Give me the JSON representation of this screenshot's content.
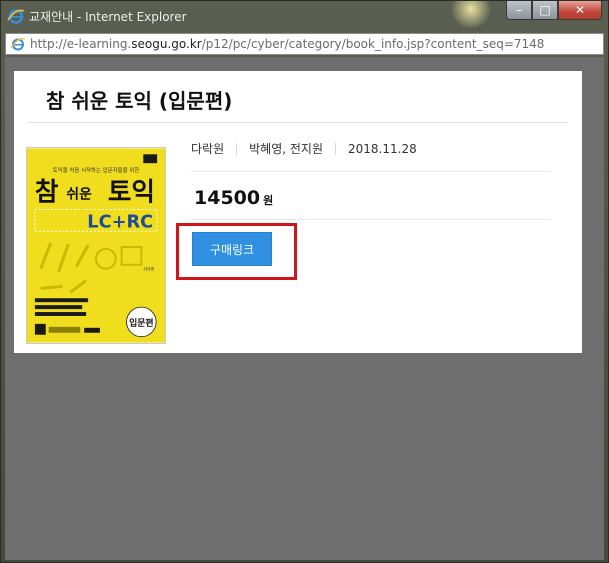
{
  "window": {
    "title": "교재안내 - Internet Explorer",
    "address_prefix": "http://e-learning.",
    "address_host": "seogu.go.kr",
    "address_path": "/p12/pc/cyber/category/book_info.jsp?content_seq=7148",
    "controls": {
      "minimize": "–",
      "maximize": "□",
      "close": "✕"
    }
  },
  "book": {
    "title": "참 쉬운 토익 (입문편)",
    "publisher": "다락원",
    "authors": "박혜영, 전지원",
    "date": "2018.11.28",
    "price": "14500",
    "price_unit": "원",
    "buy_label": "구매링크"
  },
  "cover": {
    "tagline": "토익을 처음 시작하는 입문자들을 위한",
    "title_main": "참",
    "title_mid": "쉬운",
    "title_end": "토익",
    "subtitle": "LC+RC",
    "badge": "입문편"
  },
  "colors": {
    "buy_button": "#2f8fe0",
    "highlight_border": "#d0161b",
    "cover_yellow": "#f0dd1e"
  }
}
